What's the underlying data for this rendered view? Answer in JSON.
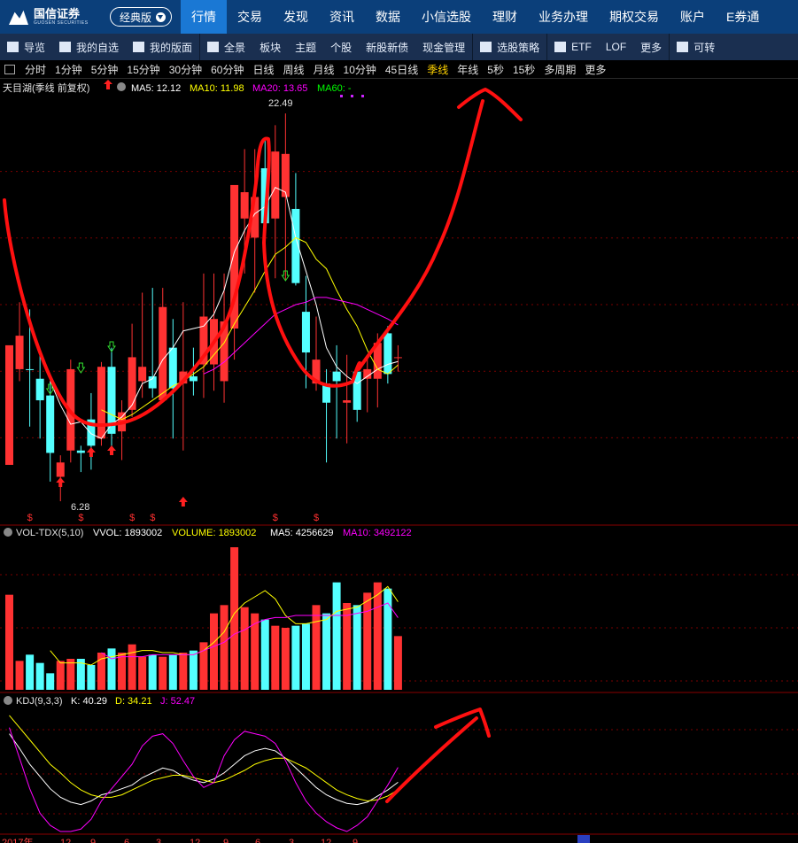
{
  "app": {
    "logo_cn": "国信证券",
    "logo_en": "GUOSEN SECURITIES",
    "classic_label": "经典版"
  },
  "topnav": [
    "行情",
    "交易",
    "发现",
    "资讯",
    "数据",
    "小信选股",
    "理财",
    "业务办理",
    "期权交易",
    "账户",
    "E券通"
  ],
  "topnav_active": "行情",
  "subnav": [
    {
      "label": "导览",
      "icon": "navigate-icon"
    },
    {
      "label": "我的自选",
      "icon": "heart-icon"
    },
    {
      "label": "我的版面",
      "icon": "layout-icon"
    },
    {
      "label": "全景",
      "icon": "panorama-icon"
    },
    {
      "label": "板块",
      "icon": ""
    },
    {
      "label": "主题",
      "icon": ""
    },
    {
      "label": "个股",
      "icon": ""
    },
    {
      "label": "新股新债",
      "icon": ""
    },
    {
      "label": "现金管理",
      "icon": ""
    },
    {
      "label": "选股策略",
      "icon": "strategy-icon"
    },
    {
      "label": "ETF",
      "icon": "etf-icon"
    },
    {
      "label": "LOF",
      "icon": ""
    },
    {
      "label": "更多",
      "icon": ""
    },
    {
      "label": "可转",
      "icon": "convertible-icon"
    }
  ],
  "periods": [
    "分时",
    "1分钟",
    "5分钟",
    "15分钟",
    "30分钟",
    "60分钟",
    "日线",
    "周线",
    "月线",
    "10分钟",
    "45日线",
    "季线",
    "年线",
    "5秒",
    "15秒",
    "多周期",
    "更多"
  ],
  "period_active": "季线",
  "kline_header": {
    "name": "天目湖(季线 前复权)",
    "ma5": "MA5: 12.12",
    "ma10": "MA10: 11.98",
    "ma20": "MA20: 13.65",
    "ma60": "MA60: -"
  },
  "vol_header": {
    "name": "VOL-TDX(5,10)",
    "vvol": "VVOL: 1893002",
    "volume": "VOLUME: 1893002",
    "ma5": "MA5: 4256629",
    "ma10": "MA10: 3492122"
  },
  "kdj_header": {
    "name": "KDJ(9,3,3)",
    "k": "K: 40.29",
    "d": "D: 34.21",
    "j": "J: 52.47"
  },
  "colors": {
    "up": "#ff3232",
    "down": "#54ffff",
    "ma5": "#ffffff",
    "ma10": "#ffff00",
    "ma20": "#ff00ff",
    "ma60": "#00ff00",
    "annotation": "#ff1010",
    "grid": "#7a0000"
  },
  "chart_data": {
    "type": "candlestick",
    "title": "天目湖(季线 前复权)",
    "max_label": "22.49",
    "min_label": "6.28",
    "price_range": [
      5.8,
      23.2
    ],
    "candles": [
      {
        "o": 7.8,
        "h": 9.5,
        "l": 7.8,
        "c": 12.8,
        "dir": "up"
      },
      {
        "o": 13.2,
        "h": 14.6,
        "l": 11.3,
        "c": 11.8,
        "dir": "up"
      },
      {
        "o": 11.8,
        "h": 14.3,
        "l": 9.4,
        "c": 11.8,
        "dir": "down"
      },
      {
        "o": 11.4,
        "h": 12.4,
        "l": 8.9,
        "c": 10.5,
        "dir": "down"
      },
      {
        "o": 10.7,
        "h": 11.3,
        "l": 7.1,
        "c": 8.3,
        "dir": "down"
      },
      {
        "o": 7.3,
        "h": 8.2,
        "l": 6.28,
        "c": 7.9,
        "dir": "up"
      },
      {
        "o": 8.4,
        "h": 12.2,
        "l": 7.9,
        "c": 11.8,
        "dir": "up"
      },
      {
        "o": 8.4,
        "h": 8.6,
        "l": 7.5,
        "c": 8.3,
        "dir": "down"
      },
      {
        "o": 9.7,
        "h": 10.8,
        "l": 7.6,
        "c": 8.6,
        "dir": "down"
      },
      {
        "o": 8.9,
        "h": 12.1,
        "l": 8.6,
        "c": 11.9,
        "dir": "up"
      },
      {
        "o": 11.9,
        "h": 12.7,
        "l": 8.5,
        "c": 9.1,
        "dir": "down"
      },
      {
        "o": 9.2,
        "h": 10.5,
        "l": 8.0,
        "c": 10.0,
        "dir": "up"
      },
      {
        "o": 10.1,
        "h": 13.7,
        "l": 9.8,
        "c": 12.3,
        "dir": "up"
      },
      {
        "o": 11.3,
        "h": 15.0,
        "l": 10.6,
        "c": 11.9,
        "dir": "up"
      },
      {
        "o": 11.0,
        "h": 15.2,
        "l": 10.6,
        "c": 11.5,
        "dir": "down"
      },
      {
        "o": 10.5,
        "h": 15.2,
        "l": 10.5,
        "c": 14.4,
        "dir": "up"
      },
      {
        "o": 11.0,
        "h": 13.9,
        "l": 8.9,
        "c": 12.7,
        "dir": "down"
      },
      {
        "o": 11.2,
        "h": 14.6,
        "l": 8.4,
        "c": 11.7,
        "dir": "up"
      },
      {
        "o": 11.3,
        "h": 12.7,
        "l": 10.7,
        "c": 11.5,
        "dir": "down"
      },
      {
        "o": 12.0,
        "h": 15.8,
        "l": 10.6,
        "c": 14.0,
        "dir": "up"
      },
      {
        "o": 12.0,
        "h": 15.8,
        "l": 10.9,
        "c": 13.9,
        "dir": "up"
      },
      {
        "o": 11.3,
        "h": 15.8,
        "l": 10.4,
        "c": 13.8,
        "dir": "up"
      },
      {
        "o": 13.5,
        "h": 18.5,
        "l": 12.2,
        "c": 19.5,
        "dir": "up"
      },
      {
        "o": 18.1,
        "h": 21.0,
        "l": 15.8,
        "c": 19.2,
        "dir": "up"
      },
      {
        "o": 17.3,
        "h": 21.0,
        "l": 15.0,
        "c": 19.0,
        "dir": "up"
      },
      {
        "o": 20.2,
        "h": 21.5,
        "l": 16.7,
        "c": 17.9,
        "dir": "down"
      },
      {
        "o": 18.1,
        "h": 22.0,
        "l": 15.6,
        "c": 20.9,
        "dir": "up"
      },
      {
        "o": 19.0,
        "h": 22.49,
        "l": 15.5,
        "c": 20.8,
        "dir": "up"
      },
      {
        "o": 18.5,
        "h": 20.0,
        "l": 15.3,
        "c": 15.4,
        "dir": "down"
      },
      {
        "o": 14.2,
        "h": 15.7,
        "l": 11.0,
        "c": 12.5,
        "dir": "down"
      },
      {
        "o": 12.2,
        "h": 14.0,
        "l": 10.9,
        "c": 11.2,
        "dir": "up"
      },
      {
        "o": 11.2,
        "h": 11.8,
        "l": 7.9,
        "c": 10.4,
        "dir": "down"
      },
      {
        "o": 11.3,
        "h": 12.8,
        "l": 8.9,
        "c": 11.7,
        "dir": "down"
      },
      {
        "o": 10.5,
        "h": 12.4,
        "l": 8.7,
        "c": 10.4,
        "dir": "up"
      },
      {
        "o": 10.1,
        "h": 11.5,
        "l": 9.6,
        "c": 11.7,
        "dir": "down"
      },
      {
        "o": 11.4,
        "h": 12.4,
        "l": 10.0,
        "c": 11.8,
        "dir": "up"
      },
      {
        "o": 11.4,
        "h": 13.3,
        "l": 10.2,
        "c": 12.9,
        "dir": "up"
      },
      {
        "o": 11.6,
        "h": 13.6,
        "l": 11.2,
        "c": 13.3,
        "dir": "down"
      },
      {
        "o": 12.3,
        "h": 12.8,
        "l": 11.7,
        "c": 12.3,
        "dir": "up"
      }
    ],
    "ma5": [
      null,
      null,
      null,
      null,
      11.3,
      10.3,
      9.5,
      9.6,
      9.1,
      8.9,
      9.5,
      9.8,
      10.3,
      11.2,
      11.4,
      12.2,
      12.7,
      13.4,
      13.5,
      13.6,
      14.1,
      15.1,
      16.7,
      17.6,
      18.3,
      18.6,
      19.4,
      19.2,
      17.3,
      15.9,
      14.5,
      12.7,
      11.9,
      11.5,
      11.2,
      11.5,
      11.8,
      12.0,
      12.12
    ],
    "ma10": [
      null,
      null,
      null,
      null,
      null,
      null,
      null,
      null,
      null,
      10.1,
      9.9,
      9.7,
      9.9,
      10.2,
      10.5,
      10.8,
      11.1,
      11.3,
      11.6,
      11.9,
      12.4,
      12.9,
      13.7,
      14.4,
      15.1,
      15.9,
      16.6,
      16.9,
      17.3,
      17.1,
      16.4,
      16.0,
      15.1,
      14.3,
      13.6,
      12.6,
      11.8,
      11.6,
      11.98
    ],
    "ma20": [
      null,
      null,
      null,
      null,
      null,
      null,
      null,
      null,
      null,
      null,
      null,
      null,
      null,
      null,
      null,
      null,
      null,
      null,
      null,
      11.6,
      11.8,
      12.1,
      12.5,
      12.9,
      13.3,
      13.7,
      14.1,
      14.3,
      14.5,
      14.6,
      14.8,
      14.8,
      14.7,
      14.6,
      14.5,
      14.3,
      14.1,
      13.9,
      13.65
    ],
    "volume": [
      4.6,
      1.4,
      1.7,
      1.3,
      0.8,
      1.4,
      1.5,
      1.5,
      1.2,
      1.8,
      2.0,
      1.8,
      2.2,
      1.6,
      1.7,
      1.6,
      1.7,
      1.8,
      1.9,
      2.3,
      3.7,
      4.1,
      6.9,
      4.0,
      3.7,
      3.4,
      3.1,
      3.0,
      3.1,
      3.2,
      4.1,
      3.7,
      5.2,
      4.2,
      4.1,
      4.7,
      5.2,
      4.9,
      2.6
    ],
    "volume_ma5": [
      null,
      null,
      null,
      null,
      1.9,
      1.3,
      1.3,
      1.3,
      1.2,
      1.5,
      1.6,
      1.7,
      1.8,
      1.9,
      1.9,
      1.8,
      1.8,
      1.7,
      1.7,
      1.9,
      2.3,
      2.8,
      3.7,
      4.2,
      4.5,
      4.8,
      4.4,
      3.6,
      3.2,
      3.2,
      3.3,
      3.4,
      3.8,
      3.9,
      4.0,
      4.3,
      4.6,
      5.0,
      4.26
    ],
    "volume_ma10": [
      null,
      null,
      null,
      null,
      null,
      null,
      null,
      null,
      null,
      1.8,
      1.5,
      1.6,
      1.6,
      1.6,
      1.7,
      1.7,
      1.7,
      1.7,
      1.7,
      1.9,
      2.1,
      2.3,
      2.7,
      2.9,
      3.2,
      3.4,
      3.5,
      3.5,
      3.6,
      3.6,
      3.6,
      3.6,
      3.6,
      3.6,
      3.7,
      3.8,
      4.0,
      4.2,
      3.49
    ],
    "kdj": {
      "k": [
        80,
        68,
        55,
        45,
        35,
        28,
        24,
        22,
        25,
        30,
        32,
        35,
        38,
        44,
        48,
        52,
        50,
        45,
        42,
        40,
        43,
        48,
        55,
        62,
        66,
        68,
        66,
        60,
        52,
        44,
        36,
        30,
        26,
        23,
        22,
        24,
        29,
        34,
        40.29
      ],
      "d": [
        95,
        85,
        75,
        65,
        55,
        48,
        40,
        34,
        30,
        28,
        28,
        30,
        34,
        38,
        42,
        44,
        46,
        46,
        44,
        42,
        40,
        42,
        46,
        50,
        55,
        58,
        60,
        60,
        56,
        52,
        46,
        40,
        34,
        30,
        27,
        25,
        26,
        29,
        34.21
      ],
      "j": [
        85,
        60,
        35,
        15,
        5,
        0,
        0,
        2,
        10,
        25,
        35,
        45,
        55,
        70,
        78,
        80,
        72,
        58,
        45,
        36,
        40,
        62,
        75,
        82,
        80,
        78,
        72,
        58,
        40,
        25,
        15,
        8,
        3,
        0,
        5,
        12,
        25,
        38,
        52.47
      ]
    },
    "xaxis_labels": [
      "2017年",
      "12",
      "9",
      "6",
      "3",
      "12",
      "9",
      "6",
      "3",
      "12",
      "9"
    ]
  },
  "markers": {
    "dollar": "$"
  }
}
